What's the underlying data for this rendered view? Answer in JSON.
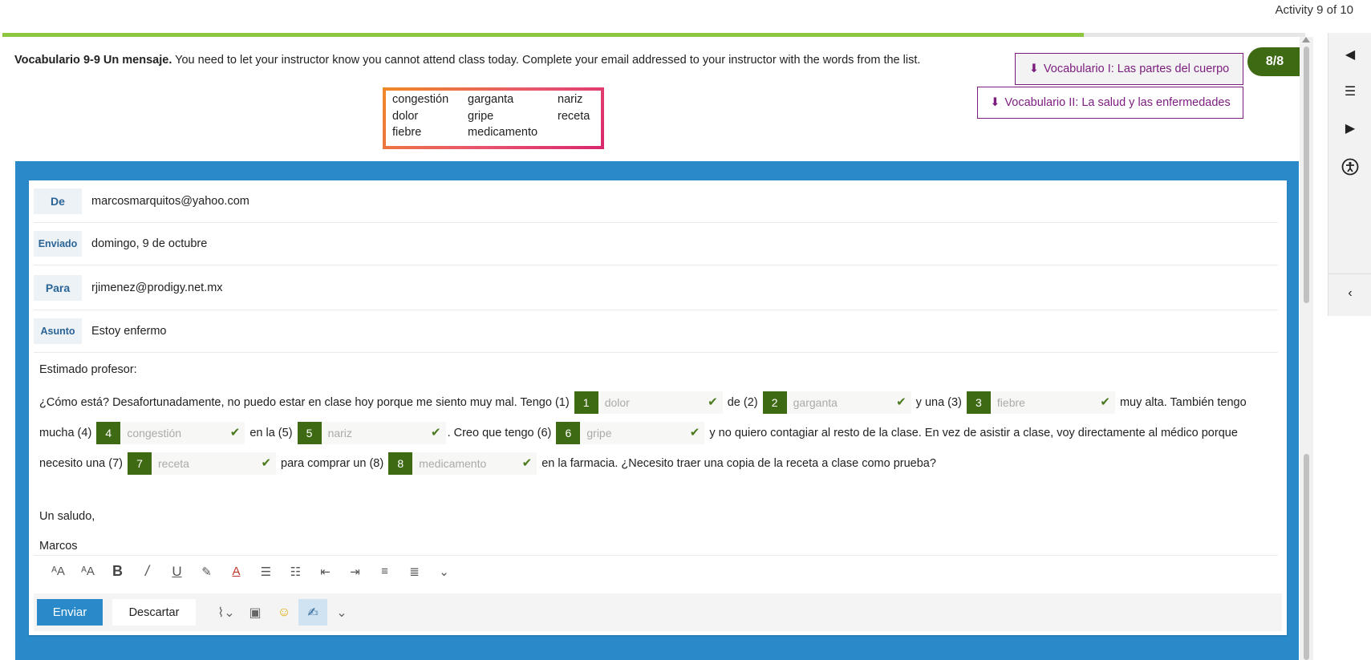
{
  "header": {
    "activity_counter": "Activity 9 of 10",
    "progress_pct": 83
  },
  "instructions": {
    "title": "Vocabulario 9-9 Un mensaje.",
    "text": " You need to let your instructor know you cannot attend class today. Complete your email addressed to your instructor with the words from the list."
  },
  "word_bank": [
    "congestión",
    "garganta",
    "nariz",
    "dolor",
    "gripe",
    "receta",
    "fiebre",
    "medicamento"
  ],
  "resources": {
    "first_label": "Vocabulario I: Las partes del cuerpo",
    "second_label": "Vocabulario II: La salud y las enfermedades",
    "score": "8/8"
  },
  "email": {
    "from_label": "De",
    "from_value": "marcosmarquitos@yahoo.com",
    "sent_label": "Enviado",
    "sent_value": "domingo, 9 de octubre",
    "to_label": "Para",
    "to_value": "rjimenez@prodigy.net.mx",
    "subject_label": "Asunto",
    "subject_value": "Estoy enfermo",
    "greeting": "Estimado profesor:",
    "closing": "Un saludo,",
    "signature": "Marcos",
    "segments": [
      "¿Cómo está? Desafortunadamente, no puedo estar en clase hoy porque me siento muy mal. Tengo (1) ",
      " de (2) ",
      " y una (3) ",
      " muy alta. También tengo mucha (4) ",
      " en la (5) ",
      ". Creo que tengo (6) ",
      " y no quiero contagiar al resto de la clase. En vez de asistir a clase, voy directamente al médico porque necesito una (7) ",
      " para comprar un (8) ",
      " en la farmacia. ¿Necesito traer una copia de la receta a clase como prueba?"
    ],
    "blanks": [
      {
        "num": "1",
        "answer": "dolor"
      },
      {
        "num": "2",
        "answer": "garganta"
      },
      {
        "num": "3",
        "answer": "fiebre"
      },
      {
        "num": "4",
        "answer": "congestión"
      },
      {
        "num": "5",
        "answer": "nariz"
      },
      {
        "num": "6",
        "answer": "gripe"
      },
      {
        "num": "7",
        "answer": "receta"
      },
      {
        "num": "8",
        "answer": "medicamento"
      }
    ]
  },
  "actions": {
    "send_label": "Enviar",
    "discard_label": "Descartar"
  },
  "toolbar_icons": [
    "font-size-decrease-icon",
    "font-size-increase-icon",
    "bold-icon",
    "italic-icon",
    "underline-icon",
    "highlight-icon",
    "font-color-icon",
    "bullet-list-icon",
    "numbered-list-icon",
    "outdent-icon",
    "indent-icon",
    "align-left-icon",
    "align-center-icon",
    "more-options-icon"
  ],
  "colors": {
    "accent_blue": "#2a8ac9",
    "green": "#3f6a14",
    "purple": "#7b1c7e",
    "progress": "#8dc63f"
  }
}
